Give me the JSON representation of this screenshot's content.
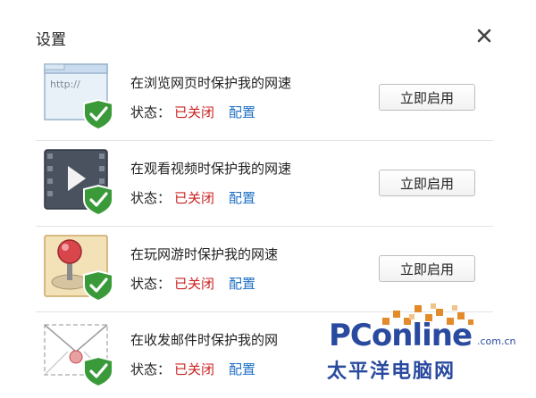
{
  "dialog": {
    "title": "设置"
  },
  "rows": [
    {
      "icon": "browser-shield-icon",
      "title": "在浏览网页时保护我的网速",
      "status_label": "状态：",
      "status_value": "已关闭",
      "config_label": "配置",
      "button_label": "立即启用",
      "icon_text": "http://"
    },
    {
      "icon": "video-shield-icon",
      "title": "在观看视频时保护我的网速",
      "status_label": "状态：",
      "status_value": "已关闭",
      "config_label": "配置",
      "button_label": "立即启用"
    },
    {
      "icon": "joystick-shield-icon",
      "title": "在玩网游时保护我的网速",
      "status_label": "状态：",
      "status_value": "已关闭",
      "config_label": "配置",
      "button_label": "立即启用"
    },
    {
      "icon": "mail-shield-icon",
      "title": "在收发邮件时保护我的网",
      "status_label": "状态：",
      "status_value": "已关闭",
      "config_label": "配置"
    }
  ],
  "watermark": {
    "logo": "PConline",
    "domain": ".com.cn",
    "chinese": "太平洋电脑网"
  },
  "colors": {
    "status_off": "#cc2222",
    "link": "#1d6fc4",
    "shield": "#3a9a3a",
    "watermark": "#2a4aa0"
  }
}
